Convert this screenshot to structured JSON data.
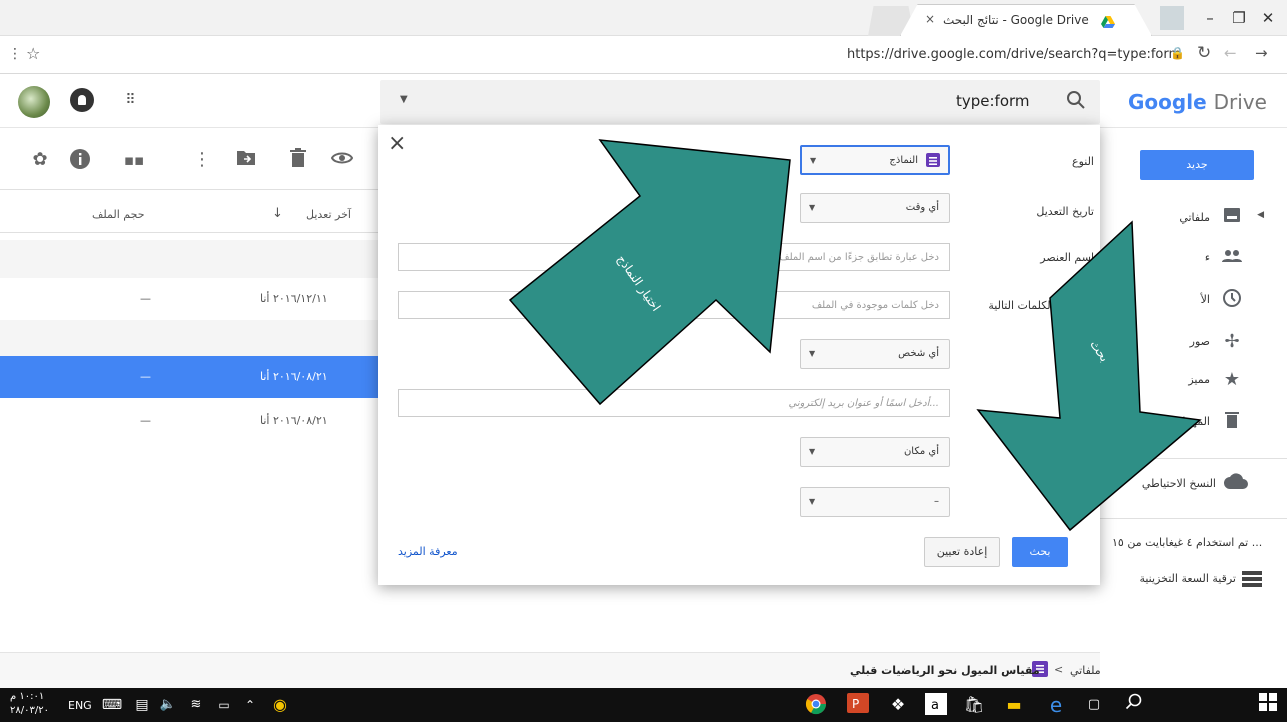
{
  "browser": {
    "tab_title": "نتائج البحث - Google Drive",
    "tab_close": "×",
    "url": "https://drive.google.com/drive/search?q=type:form"
  },
  "drive": {
    "logo_google": "Google",
    "logo_drive": "Drive",
    "search_query": "type:form",
    "new_button": "جديد"
  },
  "sidebar": {
    "items": [
      {
        "label": "ملفاتي",
        "icon": "drive-icon"
      },
      {
        "label": "ء",
        "icon": "shared-people-icon"
      },
      {
        "label": "الأ",
        "icon": "clock-icon"
      },
      {
        "label": "صور",
        "icon": "pinwheel-photos-icon"
      },
      {
        "label": "مميز",
        "icon": "star-icon"
      },
      {
        "label": "المهملات",
        "icon": "trash-icon"
      },
      {
        "label": "النسخ الاحتياطي",
        "icon": "cloud-icon"
      }
    ],
    "storage_text": "تم استخدام ٤ غيغابايت من ١٥ ...",
    "upgrade_text": "ترقية السعة التخزينية"
  },
  "list": {
    "col_size": "حجم الملف",
    "col_modified": "آخر تعديل",
    "sort_arrow": "↓",
    "rows": [
      {
        "size": "—",
        "modified": "٢٠١٦/١٢/١١ أنا",
        "selected": false
      },
      {
        "size": "—",
        "modified": "٢٠١٦/٠٨/٢١ أنا",
        "selected": true
      },
      {
        "size": "—",
        "modified": "٢٠١٦/٠٨/٢١ أنا",
        "selected": false
      }
    ]
  },
  "dialog": {
    "close": "×",
    "type_label": "النوع",
    "type_value": "النماذج",
    "modified_label": "تاريخ التعديل",
    "modified_value": "أي وقت",
    "item_name_label": "اسم العنصر",
    "item_name_placeholder": "دخل عبارة تطابق جزءًا من اسم الملف",
    "contains_label": "وي على الكلمات التالية",
    "contains_placeholder": "دخل كلمات موجودة في الملف",
    "owner_value": "أي شخص",
    "shared_placeholder": "أدخل اسمًا أو عنوان بريد إلكتروني...",
    "location_value": "أي مكان",
    "extra_value": "–",
    "search_button": "بحث",
    "reset_button": "إعادة تعيين",
    "learn_more": "معرفة المزيد"
  },
  "annotations": {
    "arrow1_label": "اختيار النماذج",
    "arrow2_label": "بحث"
  },
  "footer": {
    "breadcrumb_root": "ملفاتي",
    "breadcrumb_sep": "<",
    "file_name": "مقياس الميول نحو الرياضيات قبلي"
  },
  "taskbar": {
    "lang": "ENG",
    "time": "١٠:٠١ م",
    "date": "٢٨/٠٣/٢٠"
  },
  "colors": {
    "arrow_fill": "#2e8f86",
    "drive_blue": "#4285f4"
  }
}
